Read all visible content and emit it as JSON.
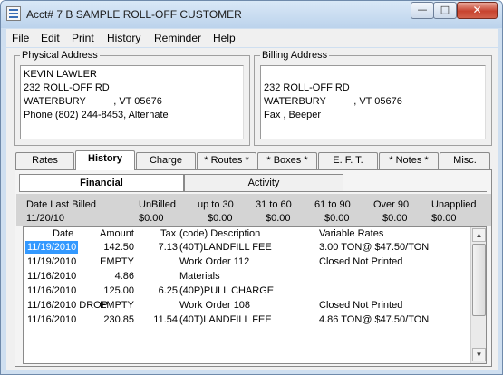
{
  "window": {
    "title": "Acct#  7 B SAMPLE ROLL-OFF CUSTOMER",
    "app_icon": "window-document-icon",
    "controls": {
      "minimize": "—",
      "maximize": "□",
      "close": "✕"
    }
  },
  "menu": [
    "File",
    "Edit",
    "Print",
    "History",
    "Reminder",
    "Help"
  ],
  "physical_address": {
    "label": "Physical Address",
    "lines": [
      "KEVIN LAWLER",
      "232 ROLL-OFF RD",
      "WATERBURY          , VT 05676",
      "Phone (802) 244-8453, Alternate"
    ]
  },
  "billing_address": {
    "label": "Billing Address",
    "lines": [
      "",
      "232 ROLL-OFF RD",
      "WATERBURY          , VT 05676",
      "Fax , Beeper"
    ]
  },
  "tabs": [
    "Rates",
    "History",
    "Charge",
    "* Routes *",
    "* Boxes *",
    "E. F. T.",
    "* Notes *",
    "Misc."
  ],
  "active_tab": "History",
  "subtabs": [
    "Financial",
    "Activity"
  ],
  "active_subtab": "Financial",
  "summary": {
    "headers": [
      "Date Last Billed",
      "UnBilled",
      "up to 30",
      "31 to 60",
      "61 to 90",
      "Over 90",
      "Unapplied"
    ],
    "values": [
      "11/20/10",
      "$0.00",
      "$0.00",
      "$0.00",
      "$0.00",
      "$0.00",
      "$0.00"
    ]
  },
  "grid": {
    "columns": [
      "Date",
      "Amount",
      "Tax",
      "(code) Description",
      "Variable Rates"
    ],
    "rows": [
      {
        "date": "11/19/2010",
        "amount": "142.50",
        "tax": "7.13",
        "desc": "(40T)LANDFILL FEE",
        "rates": "3.00 TON@ $47.50/TON"
      },
      {
        "date": "11/19/2010",
        "amount": "EMPTY",
        "tax": "",
        "desc": "Work Order   112",
        "rates": "Closed Not Printed"
      },
      {
        "date": "11/16/2010",
        "amount": "4.86",
        "tax": "",
        "desc": "Materials",
        "rates": ""
      },
      {
        "date": "11/16/2010",
        "amount": "125.00",
        "tax": "6.25",
        "desc": "(40P)PULL CHARGE",
        "rates": ""
      },
      {
        "date": "11/16/2010 DROP",
        "amount": "EMPTY",
        "tax": "",
        "desc": "Work Order   108",
        "rates": "Closed Not Printed"
      },
      {
        "date": "11/16/2010",
        "amount": "230.85",
        "tax": "11.54",
        "desc": "(40T)LANDFILL FEE",
        "rates": "4.86 TON@ $47.50/TON"
      }
    ],
    "selected_row": 0
  },
  "colors": {
    "selection": "#3399ff",
    "window_frame": "#cfdff0",
    "close_button": "#c7432f"
  }
}
